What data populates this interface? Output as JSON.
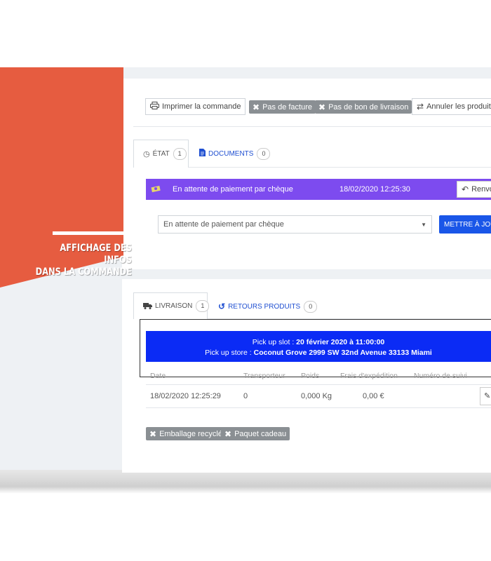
{
  "toolbar": {
    "print_label": "Imprimer la commande",
    "no_invoice_label": "Pas de facture",
    "no_delivery_slip_label": "Pas de bon de livraison",
    "cancel_products_label": "Annuler les produits"
  },
  "status_tabs": [
    {
      "label": "ÉTAT",
      "count": "1"
    },
    {
      "label": "DOCUMENTS",
      "count": "0"
    }
  ],
  "status": {
    "current": "En attente de paiement par chèque",
    "date": "18/02/2020 12:25:30",
    "resend_label": "Renvoyer",
    "select_value": "En attente de paiement par chèque",
    "update_label": "METTRE À JOUR"
  },
  "banner": {
    "line1": "AFFICHAGE DES INFOS",
    "line2": "DANS LA COMMANDE"
  },
  "shipping_tabs": [
    {
      "label": "LIVRAISON",
      "count": "1"
    },
    {
      "label": "RETOURS PRODUITS",
      "count": "0"
    }
  ],
  "pickup": {
    "slot_label": "Pick up slot : ",
    "slot_value": "20 février 2020 à 11:00:00",
    "store_label": "Pick up store : ",
    "store_value": "Coconut Grove 2999 SW 32nd Avenue 33133 Miami"
  },
  "shipping_table": {
    "headers": [
      "Date",
      "Transporteur",
      "Poids",
      "Frais d'expédition",
      "Numéro de suivi"
    ],
    "rows": [
      [
        "18/02/2020 12:25:29",
        "0",
        "0,000 Kg",
        "0,00 €",
        ""
      ]
    ]
  },
  "options": {
    "recycled_label": "Emballage recyclé",
    "gift_label": "Paquet cadeau"
  },
  "colors": {
    "banner": "#e65c40",
    "status_purple": "#7d4bef",
    "pickup_blue": "#0b2bf5",
    "update_blue": "#1a56e8"
  }
}
